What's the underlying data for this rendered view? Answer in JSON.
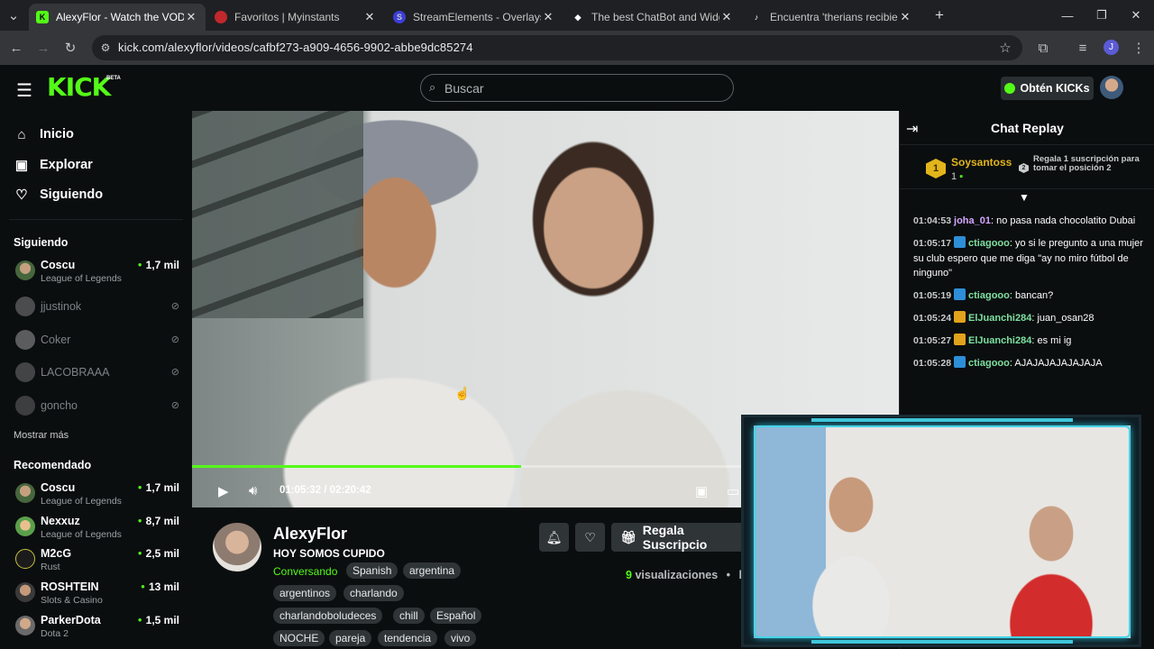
{
  "browser": {
    "tabs": [
      {
        "title": "AlexyFlor - Watch the VOD on K",
        "favicon": "kick-icon",
        "color": "#53fc18",
        "glyph": "K"
      },
      {
        "title": "Favoritos | Myinstants",
        "favicon": "myinstants-icon",
        "color": "#d9262c",
        "glyph": ""
      },
      {
        "title": "StreamElements - Overlays",
        "favicon": "streamelements-icon",
        "color": "#3b3fd8",
        "glyph": "S"
      },
      {
        "title": "The best ChatBot and Widgets",
        "favicon": "diamond-icon",
        "color": "#ffffff",
        "glyph": "◆"
      },
      {
        "title": "Encuentra 'therians recibiendo",
        "favicon": "tiktok-icon",
        "color": "#000000",
        "glyph": "♪"
      }
    ],
    "url": "kick.com/alexyflor/videos/cafbf273-a909-4656-9902-abbe9dc85274",
    "profile_initial": "J"
  },
  "kick": {
    "logo": "KICK",
    "logo_badge": "BETA",
    "search_placeholder": "Buscar",
    "get_kicks": "Obtén KICKs",
    "accent": "#53fc18"
  },
  "sidebar": {
    "nav": [
      {
        "label": "Inicio",
        "icon": "home-icon",
        "glyph": "⌂"
      },
      {
        "label": "Explorar",
        "icon": "browse-icon",
        "glyph": "▣"
      },
      {
        "label": "Siguiendo",
        "icon": "heart-icon",
        "glyph": "♡"
      }
    ],
    "following_title": "Siguiendo",
    "following": [
      {
        "name": "Coscu",
        "game": "League of Legends",
        "viewers": "1,7 mil",
        "live": true
      },
      {
        "name": "jjustinok",
        "live": false
      },
      {
        "name": "Coker",
        "live": false
      },
      {
        "name": "LACOBRAAA",
        "live": false
      },
      {
        "name": "goncho",
        "live": false
      }
    ],
    "show_more": "Mostrar más",
    "recommended_title": "Recomendado",
    "recommended": [
      {
        "name": "Coscu",
        "game": "League of Legends",
        "viewers": "1,7 mil"
      },
      {
        "name": "Nexxuz",
        "game": "League of Legends",
        "viewers": "8,7 mil"
      },
      {
        "name": "M2cG",
        "game": "Rust",
        "viewers": "2,5 mil"
      },
      {
        "name": "ROSHTEIN",
        "game": "Slots & Casino",
        "viewers": "13 mil"
      },
      {
        "name": "ParkerDota",
        "game": "Dota 2",
        "viewers": "1,5 mil"
      }
    ]
  },
  "player": {
    "current_time": "01:05:32",
    "separator": "/",
    "duration": "02:20:42",
    "progress_fraction": 0.465
  },
  "stream": {
    "streamer": "AlexyFlor",
    "title": "HOY SOMOS CUPIDO",
    "category": "Conversando",
    "tags": [
      "Spanish",
      "argentina",
      "argentinos",
      "charlando",
      "charlandoboludeces",
      "chill",
      "Español",
      "NOCHE",
      "pareja",
      "tendencia",
      "vivo"
    ],
    "gift_label": "Regala Suscripcio",
    "views_count": "9",
    "views_label": "visualizaciones",
    "views_suffix": "ha"
  },
  "chat": {
    "title": "Chat Replay",
    "top_gifter": {
      "rank": "1",
      "name": "Soysantoss",
      "count": "1"
    },
    "next_rank": {
      "rank": "2",
      "text": "Regala 1 suscripción para tomar el posición 2"
    },
    "messages": [
      {
        "time": "01:04:53",
        "user": "joha_01",
        "color": "#d4a5ff",
        "badge": "",
        "text": "no pasa nada chocolatito Dubai"
      },
      {
        "time": "01:05:17",
        "user": "ctiagooo",
        "color": "#7ee0a0",
        "badge": "#2d8fd8",
        "text": "yo si le pregunto a una mujer su club espero que me diga \"ay no miro fútbol de ninguno\""
      },
      {
        "time": "01:05:19",
        "user": "ctiagooo",
        "color": "#7ee0a0",
        "badge": "#2d8fd8",
        "text": "bancan?"
      },
      {
        "time": "01:05:24",
        "user": "ElJuanchi284",
        "color": "#7ee0a0",
        "badge": "#e2a21b",
        "text": "juan_osan28"
      },
      {
        "time": "01:05:27",
        "user": "ElJuanchi284",
        "color": "#7ee0a0",
        "badge": "#e2a21b",
        "text": "es mi ig"
      },
      {
        "time": "01:05:28",
        "user": "ctiagooo",
        "color": "#7ee0a0",
        "badge": "#2d8fd8",
        "text": "AJAJAJAJAJAJAJA"
      }
    ]
  }
}
